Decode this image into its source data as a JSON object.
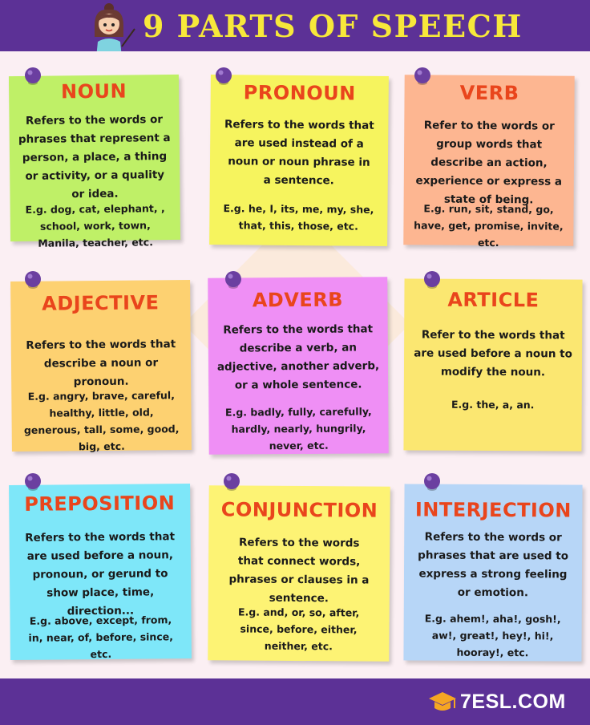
{
  "header": {
    "title": "9 PARTS OF SPEECH"
  },
  "notes": [
    {
      "term": "NOUN",
      "definition": "Refers to the words or phrases that represent a person, a place, a thing or activity, or a quality or idea.",
      "example": "E.g. dog, cat, elephant, , school, work, town, Manila, teacher, etc.",
      "color": "#bff067"
    },
    {
      "term": "PRONOUN",
      "definition": "Refers to the words that are used instead of a noun or noun phrase in a sentence.",
      "example": "E.g. he, I, its, me, my, she, that, this, those, etc.",
      "color": "#f6f45e"
    },
    {
      "term": "VERB",
      "definition": "Refer to the words or group words that describe an action, experience or express a state of being.",
      "example": "E.g. run, sit, stand, go, have, get, promise, invite, etc.",
      "color": "#fdb691"
    },
    {
      "term": "ADJECTIVE",
      "definition": "Refers to the words that describe a noun or pronoun.",
      "example": "E.g. angry, brave, careful, healthy, little, old, generous, tall, some, good, big, etc.",
      "color": "#fdd171"
    },
    {
      "term": "ADVERB",
      "definition": "Refers to the words that describe a verb, an adjective, another adverb, or a whole sentence.",
      "example": "E.g. badly, fully, carefully, hardly, nearly, hungrily, never, etc.",
      "color": "#ef8ff5"
    },
    {
      "term": "ARTICLE",
      "definition": "Refer to the words that are used before a noun to modify the noun.",
      "example": "E.g. the, a, an.",
      "color": "#fbe771"
    },
    {
      "term": "PREPOSITION",
      "definition": "Refers to the words that are used before a noun, pronoun, or gerund to show place, time, direction...",
      "example": "E.g. above, except, from, in, near, of, before, since, etc.",
      "color": "#7ee7f9"
    },
    {
      "term": "CONJUNCTION",
      "definition": "Refers to the words that connect words, phrases or clauses in a sentence.",
      "example": "E.g. and, or, so, after, since, before, either, neither, etc.",
      "color": "#fdf374"
    },
    {
      "term": "INTERJECTION",
      "definition": "Refers to the words or phrases that are used to express a strong feeling or emotion.",
      "example": "E.g. ahem!, aha!, gosh!, aw!, great!, hey!, hi!, hooray!, etc.",
      "color": "#b7d6f7"
    }
  ],
  "footer": {
    "logo_text": "7ESL.COM"
  },
  "colors": {
    "bar": "#5c3196",
    "title": "#f7e83a",
    "term": "#e9451c",
    "pin": "#6b3fa0",
    "logo_cap": "#f5a623"
  },
  "icons": {
    "pin": "pushpin-icon",
    "logo": "graduation-cap-icon",
    "mascot": "teacher-girl-icon"
  }
}
